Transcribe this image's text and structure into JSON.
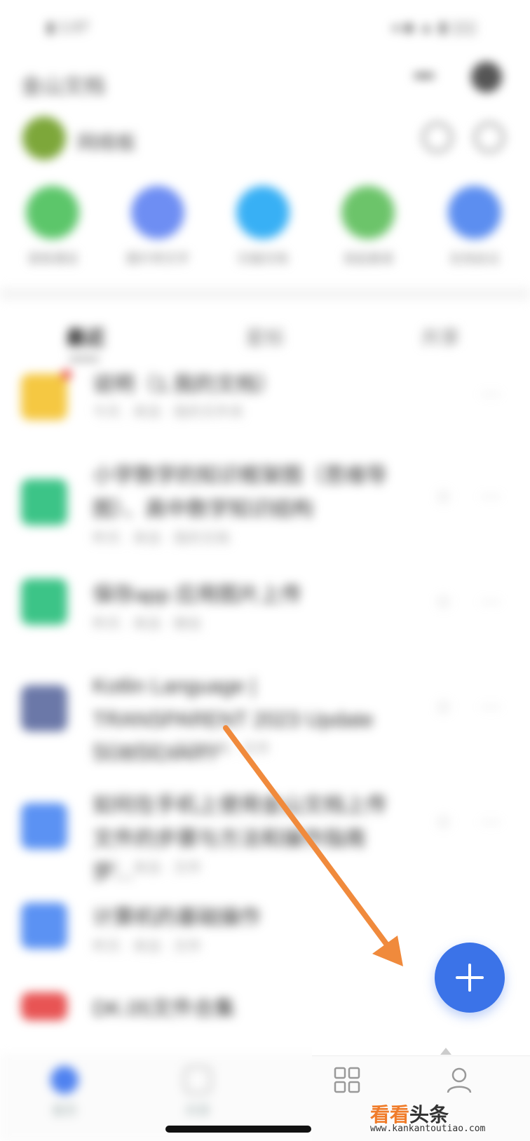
{
  "status_bar": {
    "left": "▮ 1:07",
    "right": "◂ ◆ ▲ ▮ ▯▯▯"
  },
  "header": {
    "title": "金山文档"
  },
  "user": {
    "name": "网络板"
  },
  "quick_actions": [
    {
      "label": "语音通话",
      "color": "#5cc66a"
    },
    {
      "label": "图片转文字",
      "color": "#6e8ef3"
    },
    {
      "label": "扫描文档",
      "color": "#38b0f5"
    },
    {
      "label": "发起邀请",
      "color": "#6cc46a"
    },
    {
      "label": "在线会议",
      "color": "#5c8ef0"
    }
  ],
  "tabs": [
    {
      "label": "最近"
    },
    {
      "label": "星标"
    },
    {
      "label": "共享"
    }
  ],
  "files": [
    {
      "title": "说明（1.我的文档）",
      "subtitle": "今天 · 来自 · 我的文件夹",
      "icon_color": "#f5c842",
      "badge": true
    },
    {
      "title": "小学数学的知识框架图（思维导图）、高中数学知识结构",
      "subtitle": "昨天 · 来自 · 我的文档",
      "icon_color": "#3cc487",
      "badge": false
    },
    {
      "title": "保存app 应用图片上传",
      "subtitle": "昨天 · 来自 · 微信",
      "icon_color": "#3cc487",
      "badge": false
    },
    {
      "title": "Kotlin Language | TRANSPARENT 2023 Update SUBSIDIARY",
      "subtitle": "昨天 · 来自 · 我的文档 · 文件",
      "icon_color": "#6b78a8",
      "badge": false
    },
    {
      "title": "如何在手机上使用金山文档上传文件的步骤与方法和操作指南步…",
      "subtitle": "昨天 · 来自 · 文件",
      "icon_color": "#5b92f3",
      "badge": false
    },
    {
      "title": "计算机的基础操作",
      "subtitle": "昨天 · 来自 · 文件",
      "icon_color": "#5b92f3",
      "badge": false
    },
    {
      "title": "DK.05文件合集",
      "subtitle": "",
      "icon_color": "#e85454",
      "badge": false
    }
  ],
  "bottom_nav": [
    {
      "label": "首页"
    },
    {
      "label": "共享"
    },
    {
      "label": ""
    },
    {
      "label": ""
    }
  ],
  "fab": {
    "icon": "plus-icon",
    "color": "#3b73e8"
  },
  "watermark": {
    "text": "看看头条",
    "url": "www.kankantoutiao.com",
    "color_primary": "#f07c2a",
    "color_secondary": "#333333"
  },
  "annotation": {
    "arrow_color": "#f08a3c"
  }
}
